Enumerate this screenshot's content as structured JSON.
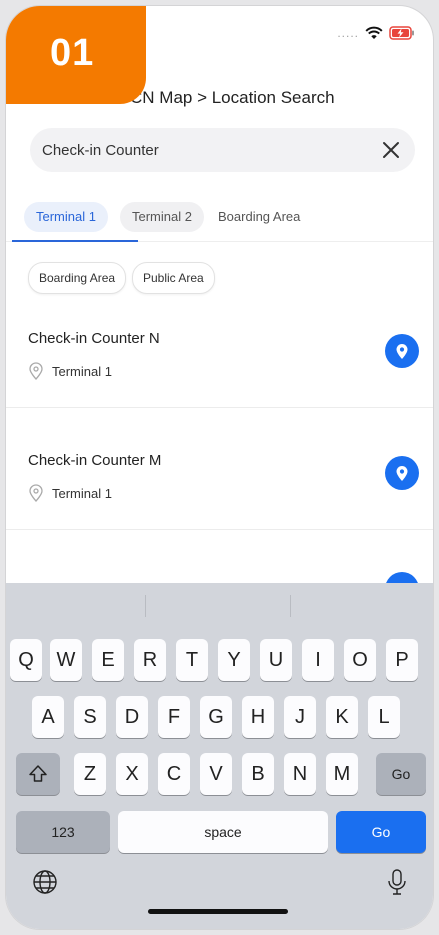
{
  "badge": {
    "text": "01"
  },
  "breadcrumb": {
    "text": "CN Map > Location Search"
  },
  "search": {
    "value": "Check-in Counter"
  },
  "tabs": [
    {
      "label": "Terminal 1",
      "active": true
    },
    {
      "label": "Terminal 2",
      "active": false
    },
    {
      "label": "Boarding Area",
      "active": false
    }
  ],
  "chips": [
    {
      "label": "Boarding Area"
    },
    {
      "label": "Public Area"
    }
  ],
  "results": [
    {
      "title": "Check-in Counter N",
      "location": "Terminal 1"
    },
    {
      "title": "Check-in Counter M",
      "location": "Terminal 1"
    }
  ],
  "keyboard": {
    "row1": [
      "Q",
      "W",
      "E",
      "R",
      "T",
      "Y",
      "U",
      "I",
      "O",
      "P"
    ],
    "row2": [
      "A",
      "S",
      "D",
      "F",
      "G",
      "H",
      "J",
      "K",
      "L"
    ],
    "row3": [
      "Z",
      "X",
      "C",
      "V",
      "B",
      "N",
      "M"
    ],
    "return_small": "Go",
    "numbers": "123",
    "space": "space",
    "go": "Go"
  },
  "colors": {
    "accent": "#1a6ff0",
    "tab_active": "#2a66d9",
    "badge": "#f47a00"
  },
  "icons": [
    "wifi-icon",
    "battery-charging-icon",
    "close-icon",
    "location-pin-icon",
    "map-pin-icon",
    "shift-icon",
    "globe-icon",
    "microphone-icon"
  ]
}
